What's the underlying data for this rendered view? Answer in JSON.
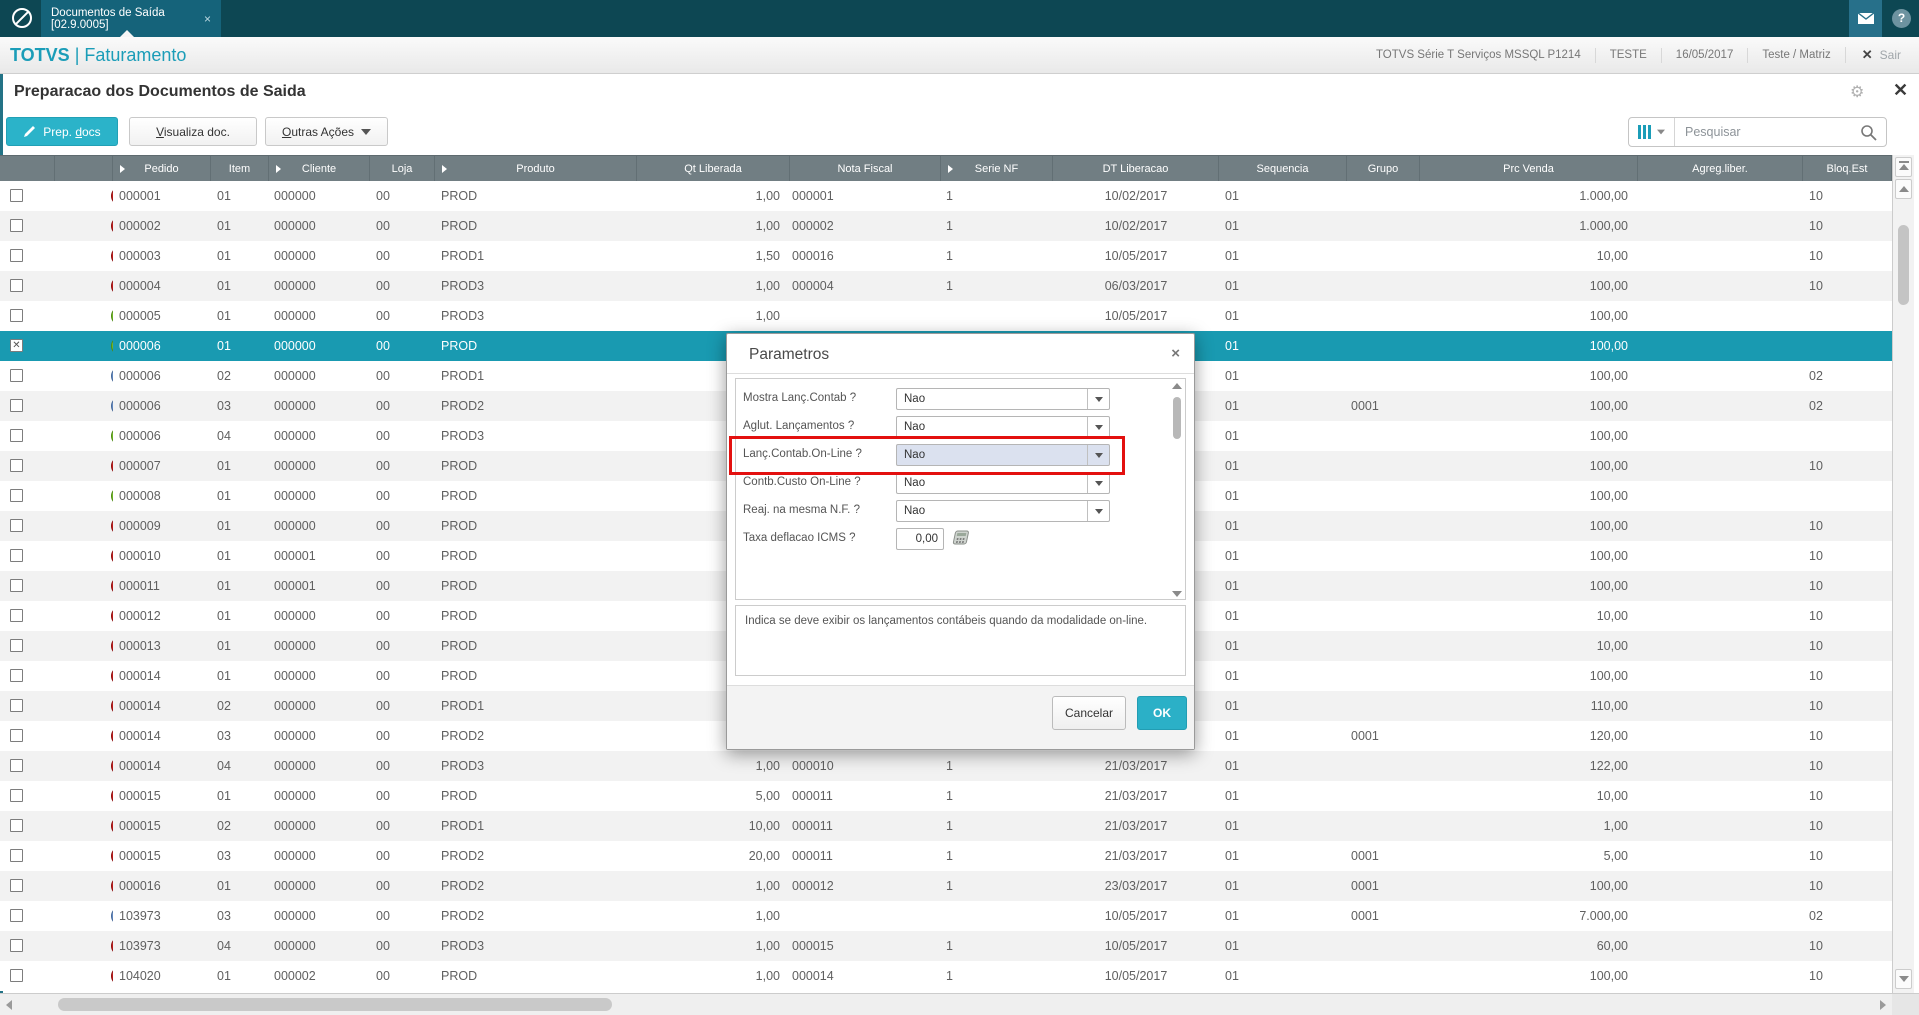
{
  "chrome": {
    "tab_title": "Documentos de Saída [02.9.0005]",
    "tab_close": "×",
    "brand_app": "TOTVS",
    "brand_sep": " | ",
    "brand_module": "Faturamento",
    "env_items": [
      "TOTVS Série T Serviços MSSQL P1214",
      "TESTE",
      "16/05/2017",
      "Teste / Matriz"
    ],
    "logout_x": "✕",
    "logout_label": "Sair",
    "help_glyph": "?",
    "gear_glyph": "⚙",
    "page_close": "✕",
    "page_title": "Preparacao dos Documentos de Saida"
  },
  "toolbar": {
    "prep_pre": "Prep. ",
    "prep_u": "d",
    "prep_post": "ocs",
    "vis_u": "V",
    "vis_post": "isualiza doc.",
    "out_u": "O",
    "out_post": "utras Ações",
    "search_placeholder": "Pesquisar"
  },
  "table": {
    "headers": [
      "",
      "",
      "Pedido",
      "Item",
      "Cliente",
      "Loja",
      "Produto",
      "Qt Liberada",
      "Nota Fiscal",
      "Serie NF",
      "DT Liberacao",
      "Sequencia",
      "Grupo",
      "Prc Venda",
      "Agreg.liber.",
      "Bloq.Est"
    ],
    "arrow_cols": [
      2,
      4,
      6,
      9
    ],
    "rows": [
      {
        "status": "red",
        "checked": false,
        "selected": false,
        "c": [
          "000001",
          "01",
          "000000",
          "00",
          "PROD",
          "1,00",
          "000001",
          "1",
          "10/02/2017",
          "01",
          "",
          "1.000,00",
          "",
          "10"
        ]
      },
      {
        "status": "red",
        "checked": false,
        "selected": false,
        "c": [
          "000002",
          "01",
          "000000",
          "00",
          "PROD",
          "1,00",
          "000002",
          "1",
          "10/02/2017",
          "01",
          "",
          "1.000,00",
          "",
          "10"
        ]
      },
      {
        "status": "red",
        "checked": false,
        "selected": false,
        "c": [
          "000003",
          "01",
          "000000",
          "00",
          "PROD1",
          "1,50",
          "000016",
          "1",
          "10/05/2017",
          "01",
          "",
          "10,00",
          "",
          "10"
        ]
      },
      {
        "status": "red",
        "checked": false,
        "selected": false,
        "c": [
          "000004",
          "01",
          "000000",
          "00",
          "PROD3",
          "1,00",
          "000004",
          "1",
          "06/03/2017",
          "01",
          "",
          "100,00",
          "",
          "10"
        ]
      },
      {
        "status": "green",
        "checked": false,
        "selected": false,
        "c": [
          "000005",
          "01",
          "000000",
          "00",
          "PROD3",
          "1,00",
          "",
          "",
          "10/05/2017",
          "01",
          "",
          "100,00",
          "",
          ""
        ]
      },
      {
        "status": "green",
        "checked": true,
        "selected": true,
        "c": [
          "000006",
          "01",
          "000000",
          "00",
          "PROD",
          "",
          "",
          "",
          "",
          "01",
          "",
          "100,00",
          "",
          ""
        ]
      },
      {
        "status": "blue",
        "checked": false,
        "selected": false,
        "c": [
          "000006",
          "02",
          "000000",
          "00",
          "PROD1",
          "",
          "",
          "",
          "",
          "01",
          "",
          "100,00",
          "",
          "02"
        ]
      },
      {
        "status": "blue",
        "checked": false,
        "selected": false,
        "c": [
          "000006",
          "03",
          "000000",
          "00",
          "PROD2",
          "",
          "",
          "",
          "",
          "01",
          "0001",
          "100,00",
          "",
          "02"
        ]
      },
      {
        "status": "green",
        "checked": false,
        "selected": false,
        "c": [
          "000006",
          "04",
          "000000",
          "00",
          "PROD3",
          "",
          "",
          "",
          "",
          "01",
          "",
          "100,00",
          "",
          ""
        ]
      },
      {
        "status": "red",
        "checked": false,
        "selected": false,
        "c": [
          "000007",
          "01",
          "000000",
          "00",
          "PROD",
          "",
          "",
          "",
          "",
          "01",
          "",
          "100,00",
          "",
          "10"
        ]
      },
      {
        "status": "green",
        "checked": false,
        "selected": false,
        "c": [
          "000008",
          "01",
          "000000",
          "00",
          "PROD",
          "",
          "",
          "",
          "",
          "01",
          "",
          "100,00",
          "",
          ""
        ]
      },
      {
        "status": "red",
        "checked": false,
        "selected": false,
        "c": [
          "000009",
          "01",
          "000000",
          "00",
          "PROD",
          "",
          "",
          "",
          "",
          "01",
          "",
          "100,00",
          "",
          "10"
        ]
      },
      {
        "status": "red",
        "checked": false,
        "selected": false,
        "c": [
          "000010",
          "01",
          "000001",
          "00",
          "PROD",
          "",
          "",
          "",
          "",
          "01",
          "",
          "100,00",
          "",
          "10"
        ]
      },
      {
        "status": "red",
        "checked": false,
        "selected": false,
        "c": [
          "000011",
          "01",
          "000001",
          "00",
          "PROD",
          "",
          "",
          "",
          "",
          "01",
          "",
          "100,00",
          "",
          "10"
        ]
      },
      {
        "status": "red",
        "checked": false,
        "selected": false,
        "c": [
          "000012",
          "01",
          "000000",
          "00",
          "PROD",
          "",
          "",
          "",
          "",
          "01",
          "",
          "10,00",
          "",
          "10"
        ]
      },
      {
        "status": "red",
        "checked": false,
        "selected": false,
        "c": [
          "000013",
          "01",
          "000000",
          "00",
          "PROD",
          "",
          "",
          "",
          "",
          "01",
          "",
          "10,00",
          "",
          "10"
        ]
      },
      {
        "status": "red",
        "checked": false,
        "selected": false,
        "c": [
          "000014",
          "01",
          "000000",
          "00",
          "PROD",
          "",
          "",
          "",
          "",
          "01",
          "",
          "100,00",
          "",
          "10"
        ]
      },
      {
        "status": "red",
        "checked": false,
        "selected": false,
        "c": [
          "000014",
          "02",
          "000000",
          "00",
          "PROD1",
          "",
          "",
          "",
          "",
          "01",
          "",
          "110,00",
          "",
          "10"
        ]
      },
      {
        "status": "red",
        "checked": false,
        "selected": false,
        "c": [
          "000014",
          "03",
          "000000",
          "00",
          "PROD2",
          "",
          "",
          "",
          "",
          "01",
          "0001",
          "120,00",
          "",
          "10"
        ]
      },
      {
        "status": "red",
        "checked": false,
        "selected": false,
        "c": [
          "000014",
          "04",
          "000000",
          "00",
          "PROD3",
          "1,00",
          "000010",
          "1",
          "21/03/2017",
          "01",
          "",
          "122,00",
          "",
          "10"
        ]
      },
      {
        "status": "red",
        "checked": false,
        "selected": false,
        "c": [
          "000015",
          "01",
          "000000",
          "00",
          "PROD",
          "5,00",
          "000011",
          "1",
          "21/03/2017",
          "01",
          "",
          "10,00",
          "",
          "10"
        ]
      },
      {
        "status": "red",
        "checked": false,
        "selected": false,
        "c": [
          "000015",
          "02",
          "000000",
          "00",
          "PROD1",
          "10,00",
          "000011",
          "1",
          "21/03/2017",
          "01",
          "",
          "1,00",
          "",
          "10"
        ]
      },
      {
        "status": "red",
        "checked": false,
        "selected": false,
        "c": [
          "000015",
          "03",
          "000000",
          "00",
          "PROD2",
          "20,00",
          "000011",
          "1",
          "21/03/2017",
          "01",
          "0001",
          "5,00",
          "",
          "10"
        ]
      },
      {
        "status": "red",
        "checked": false,
        "selected": false,
        "c": [
          "000016",
          "01",
          "000000",
          "00",
          "PROD2",
          "1,00",
          "000012",
          "1",
          "23/03/2017",
          "01",
          "0001",
          "100,00",
          "",
          "10"
        ]
      },
      {
        "status": "blue",
        "checked": false,
        "selected": false,
        "c": [
          "103973",
          "03",
          "000000",
          "00",
          "PROD2",
          "1,00",
          "",
          "",
          "10/05/2017",
          "01",
          "0001",
          "7.000,00",
          "",
          "02"
        ]
      },
      {
        "status": "red",
        "checked": false,
        "selected": false,
        "c": [
          "103973",
          "04",
          "000000",
          "00",
          "PROD3",
          "1,00",
          "000015",
          "1",
          "10/05/2017",
          "01",
          "",
          "60,00",
          "",
          "10"
        ]
      },
      {
        "status": "red",
        "checked": false,
        "selected": false,
        "c": [
          "104020",
          "01",
          "000002",
          "00",
          "PROD",
          "1,00",
          "000014",
          "1",
          "10/05/2017",
          "01",
          "",
          "100,00",
          "",
          "10"
        ]
      }
    ]
  },
  "modal": {
    "title": "Parametros",
    "close": "×",
    "fields": [
      {
        "label": "Mostra Lanç.Contab ?",
        "value": "Nao",
        "type": "combo",
        "highlighted": false
      },
      {
        "label": "Aglut. Lançamentos ?",
        "value": "Nao",
        "type": "combo",
        "highlighted": false
      },
      {
        "label": "Lanç.Contab.On-Line ?",
        "value": "Nao",
        "type": "combo",
        "highlighted": true
      },
      {
        "label": "Contb.Custo On-Line ?",
        "value": "Nao",
        "type": "combo",
        "highlighted": false
      },
      {
        "label": "Reaj. na mesma N.F. ?",
        "value": "Nao",
        "type": "combo",
        "highlighted": false
      },
      {
        "label": "Taxa deflacao ICMS ?",
        "value": "0,00",
        "type": "input",
        "highlighted": false
      }
    ],
    "help_text": "Indica se deve exibir os lançamentos contábeis quando da modalidade on-line.",
    "cancel_label": "Cancelar",
    "ok_label": "OK",
    "annotation_color": "#e3100f"
  }
}
